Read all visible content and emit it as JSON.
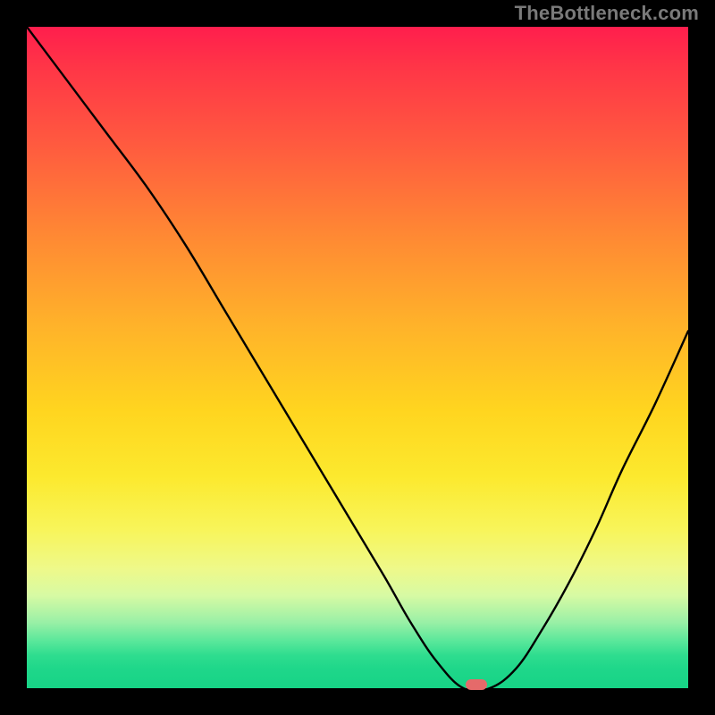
{
  "watermark": {
    "text": "TheBottleneck.com"
  },
  "chart_data": {
    "type": "line",
    "title": "",
    "xlabel": "",
    "ylabel": "",
    "xlim": [
      0,
      100
    ],
    "ylim": [
      0,
      100
    ],
    "x": [
      0,
      6,
      12,
      18,
      24,
      30,
      36,
      42,
      48,
      54,
      58,
      62,
      66,
      70,
      74,
      78,
      82,
      86,
      90,
      95,
      100
    ],
    "values": [
      100,
      92,
      84,
      76,
      67,
      57,
      47,
      37,
      27,
      17,
      10,
      4,
      0,
      0,
      3,
      9,
      16,
      24,
      33,
      43,
      54
    ],
    "marker": {
      "x": 68,
      "y": 0
    },
    "gradient_colors": {
      "top": "#ff1e4d",
      "mid": "#ffd51f",
      "bottom": "#17d386"
    }
  }
}
